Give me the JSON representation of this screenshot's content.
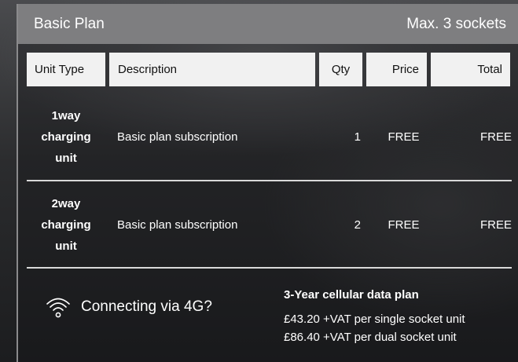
{
  "plan": {
    "name": "Basic Plan",
    "max_sockets": "Max. 3 sockets"
  },
  "table": {
    "headers": [
      "Unit Type",
      "Description",
      "Qty",
      "Price",
      "Total"
    ],
    "rows": [
      {
        "unit": [
          "1way",
          "charging",
          "unit"
        ],
        "description": "Basic plan subscription",
        "qty": "1",
        "price": "FREE",
        "total": "FREE"
      },
      {
        "unit": [
          "2way",
          "charging",
          "unit"
        ],
        "description": "Basic plan subscription",
        "qty": "2",
        "price": "FREE",
        "total": "FREE"
      }
    ]
  },
  "connectivity": {
    "icon": "wifi-icon",
    "label": "Connecting via 4G?",
    "plan_title": "3-Year cellular data plan",
    "single_price": "£43.20 +VAT per single socket unit",
    "dual_price": "£86.40 +VAT per dual socket unit"
  },
  "colors": {
    "header_bg": "#7e7e80",
    "table_header_bg": "#f1f1f1",
    "divider": "#d9d9d9"
  }
}
